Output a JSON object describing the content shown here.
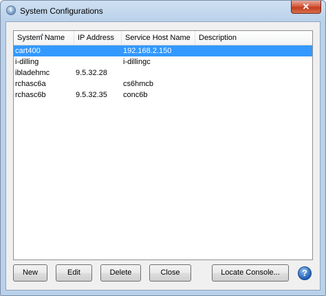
{
  "window": {
    "title": "System Configurations",
    "close_glyph": "✕"
  },
  "table": {
    "columns": [
      "System Name",
      "IP Address",
      "Service Host Name",
      "Description"
    ],
    "rows": [
      {
        "system_name": "cart400",
        "ip": "",
        "host": "192.168.2.150",
        "description": "",
        "selected": true
      },
      {
        "system_name": "i-dilling",
        "ip": "",
        "host": "i-dillingc",
        "description": ""
      },
      {
        "system_name": "ibladehmc",
        "ip": "9.5.32.28",
        "host": "",
        "description": ""
      },
      {
        "system_name": "rchasc6a",
        "ip": "",
        "host": "cs6hmcb",
        "description": ""
      },
      {
        "system_name": "rchasc6b",
        "ip": "9.5.32.35",
        "host": "conc6b",
        "description": ""
      }
    ]
  },
  "buttons": {
    "new": "New",
    "edit": "Edit",
    "delete": "Delete",
    "close": "Close",
    "locate": "Locate Console...",
    "help": "?"
  },
  "colors": {
    "selection": "#3399ff",
    "close_button": "#c84a2a"
  },
  "icons": {
    "title": "app-icon",
    "help": "help-icon",
    "close": "close-icon"
  }
}
